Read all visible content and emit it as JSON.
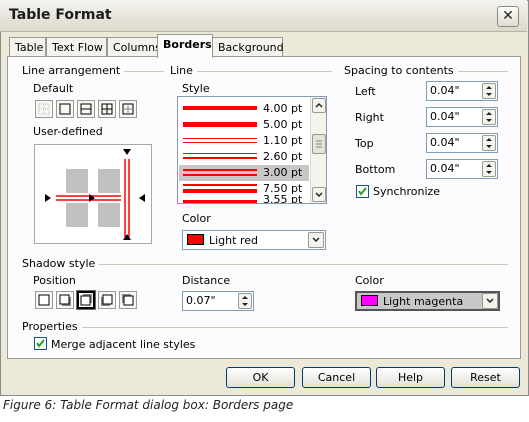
{
  "window": {
    "title": "Table Format"
  },
  "tabs": [
    {
      "label": "Table"
    },
    {
      "label": "Text Flow"
    },
    {
      "label": "Columns"
    },
    {
      "label": "Borders"
    },
    {
      "label": "Background"
    }
  ],
  "line_arrangement": {
    "title": "Line arrangement",
    "default_label": "Default",
    "user_defined_label": "User-defined"
  },
  "line": {
    "title": "Line",
    "style_label": "Style",
    "styles": [
      "4.00 pt",
      "5.00 pt",
      "1.10 pt",
      "2.60 pt",
      "3.00 pt",
      "7.50 pt",
      "3.55 pt"
    ],
    "selected_style": "3.00 pt",
    "color_label": "Color",
    "color_value": "Light red",
    "color_hex": "#ff0000"
  },
  "spacing": {
    "title": "Spacing to contents",
    "left_label": "Left",
    "left_value": "0.04\"",
    "right_label": "Right",
    "right_value": "0.04\"",
    "top_label": "Top",
    "top_value": "0.04\"",
    "bottom_label": "Bottom",
    "bottom_value": "0.04\"",
    "synchronize_label": "Synchronize",
    "synchronize_checked": true
  },
  "shadow": {
    "title": "Shadow style",
    "position_label": "Position",
    "distance_label": "Distance",
    "distance_value": "0.07\"",
    "color_label": "Color",
    "color_value": "Light magenta",
    "color_hex": "#ff00ff"
  },
  "properties": {
    "title": "Properties",
    "merge_label": "Merge adjacent line styles",
    "merge_checked": true
  },
  "buttons": {
    "ok": "OK",
    "cancel": "Cancel",
    "help": "Help",
    "reset": "Reset"
  },
  "caption": "Figure 6: Table Format dialog box: Borders page"
}
